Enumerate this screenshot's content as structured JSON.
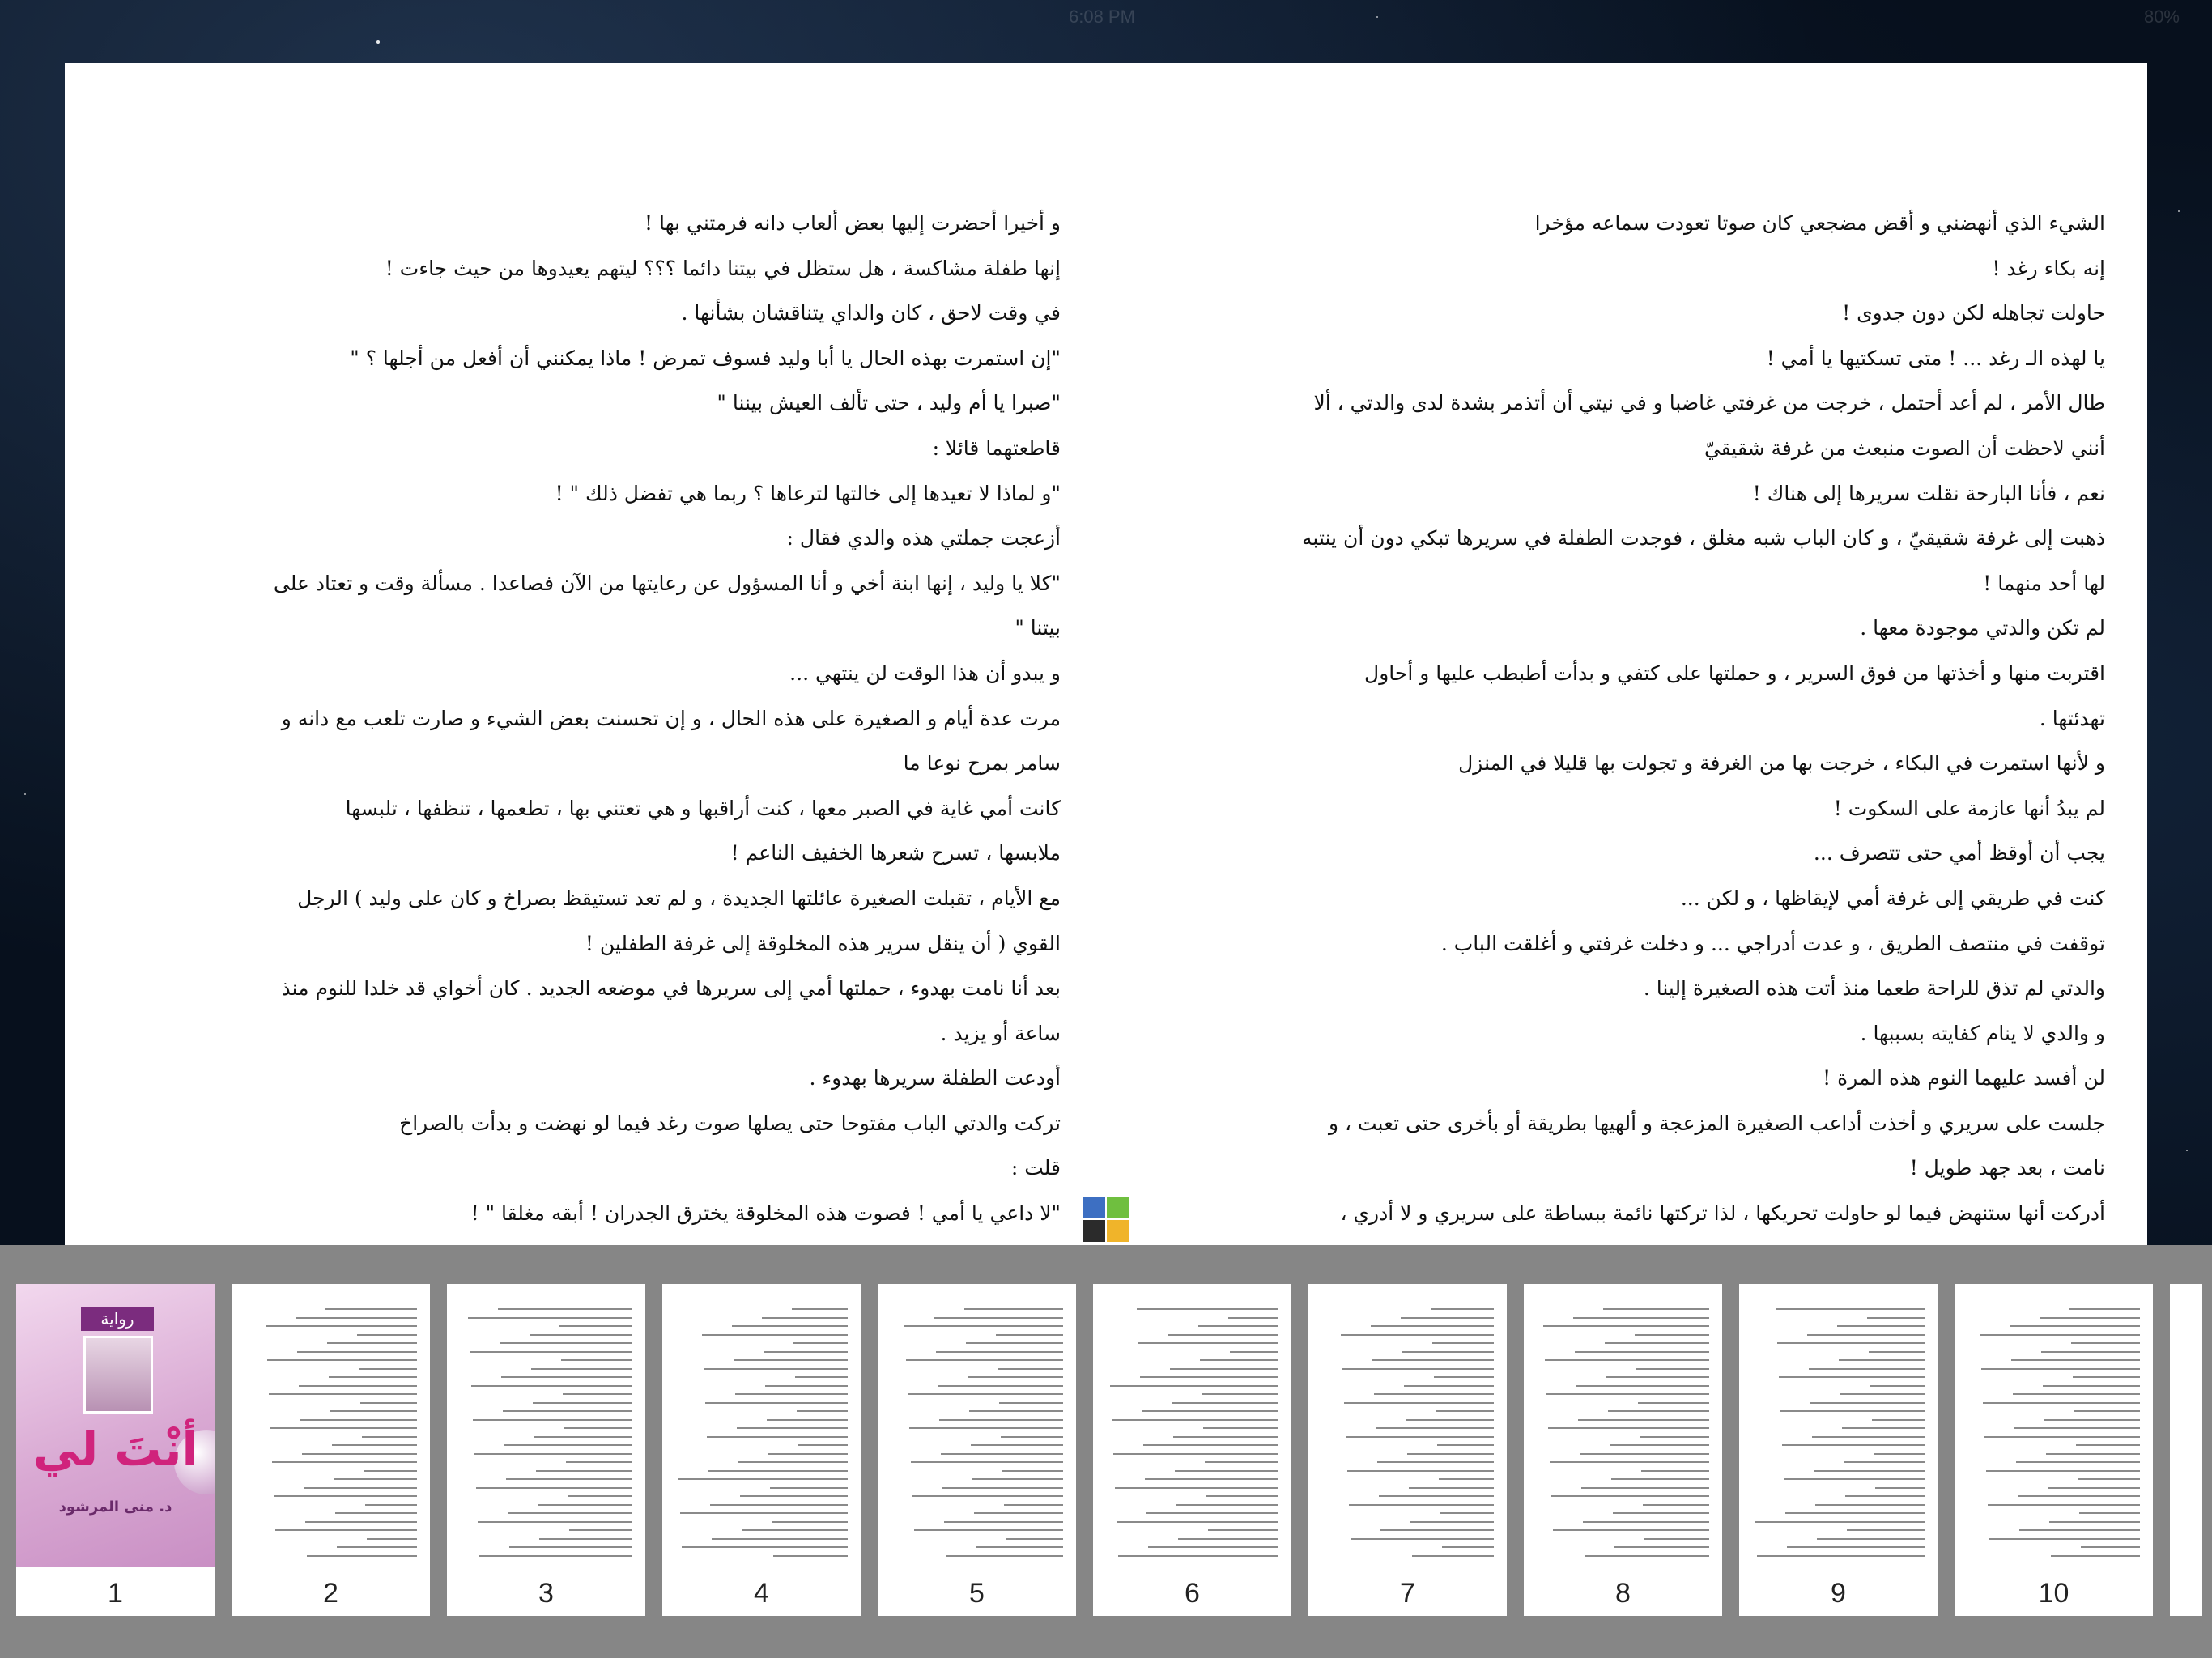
{
  "status_bar": {
    "time": "6:08 PM",
    "battery": "80%"
  },
  "book": {
    "right_page_lines": [
      "الشيء الذي أنهضني و أقض مضجعي كان صوتا تعودت سماعه مؤخرا",
      "إنه بكاء رغد !",
      "حاولت تجاهله لكن دون جدوى !",
      "يا لهذه الـ رغد ... ! متى تسكتيها يا أمي !",
      "طال الأمر ، لم أعد أحتمل ، خرجت من غرفتي غاضبا و في نيتي أن أتذمر بشدة لدى والدتي ، ألا",
      "أنني لاحظت أن الصوت منبعث من غرفة شقيقيّ",
      "نعم ، فأنا البارحة نقلت سريرها إلى هناك !",
      "ذهبت إلى غرفة شقيقيّ ، و كان الباب شبه مغلق ، فوجدت الطفلة في سريرها تبكي دون أن ينتبه",
      "لها أحد منهما !",
      "لم تكن والدتي موجودة معها .",
      "اقتربت منها و أخذتها من فوق السرير ، و حملتها على كتفي و بدأت أطبطب عليها و أحاول",
      "تهدئتها .",
      "و لأنها استمرت في البكاء ، خرجت بها من الغرفة و تجولت بها قليلا في المنزل",
      "لم يبدُ أنها عازمة على السكوت !",
      "يجب أن أوقظ أمي حتى تتصرف ...",
      "كنت في طريقي إلى غرفة أمي لإيقاظها ، و لكن ...",
      "توقفت في منتصف الطريق ، و عدت أدراجي ... و دخلت غرفتي و أغلقت الباب .",
      "والدتي لم تذق للراحة طعما منذ أتت هذه الصغيرة إلينا .",
      "و والدي لا ينام كفايته بسببها .",
      "لن أفسد عليهما النوم هذه المرة !",
      "جلست على سريري و أخذت أداعب الصغيرة المزعجة و ألهيها بطريقة أو بأخرى حتى تعبت ، و",
      "نامت ، بعد جهد طويل !",
      "أدركت أنها ستنهض فيما لو حاولت تحريكها ، لذا تركتها نائمة ببساطة على سريري و لا أدري ،"
    ],
    "left_page_lines": [
      "و أخيرا أحضرت إليها بعض ألعاب دانه فرمتني بها !",
      "إنها طفلة مشاكسة ، هل ستظل في بيتنا دائما ؟؟؟ ليتهم يعيدوها من حيث جاءت !",
      "في وقت لاحق ، كان والداي يتناقشان بشأنها .",
      "\"إن استمرت بهذه الحال يا أبا وليد فسوف تمرض ! ماذا يمكنني أن أفعل من أجلها ؟ \"",
      "\"صبرا يا أم وليد ، حتى تألف العيش بيننا \"",
      "قاطعتهما قائلا :",
      "\"و لماذا لا تعيدها إلى خالتها لترعاها ؟ ربما هي تفضل ذلك \" !",
      "أزعجت جملتي هذه والدي فقال :",
      "\"كلا يا وليد ، إنها ابنة أخي و أنا المسؤول عن رعايتها من الآن فصاعدا . مسألة وقت و تعتاد على",
      "بيتنا \"",
      "و يبدو أن هذا الوقت لن ينتهي ...",
      "مرت عدة أيام و الصغيرة على هذه الحال ، و إن تحسنت بعض الشيء و صارت تلعب مع دانه و",
      "سامر بمرح نوعا ما",
      "كانت أمي غاية في الصبر معها ، كنت أراقبها و هي تعتني بها ، تطعمها ، تنظفها ، تلبسها",
      "ملابسها ، تسرح شعرها الخفيف الناعم !",
      "مع الأيام ، تقبلت الصغيرة عائلتها الجديدة ، و لم تعد تستيقظ بصراخ و كان على وليد ) الرجل",
      "القوي ( أن ينقل سرير هذه المخلوقة إلى غرفة الطفلين !",
      "بعد أنا نامت بهدوء ، حملتها أمي إلى سريرها في موضعه الجديد . كان أخواي قد خلدا للنوم منذ",
      "ساعة أو يزيد .",
      "أودعت الطفلة سريرها بهدوء .",
      "تركت والدتي الباب مفتوحا حتى يصلها صوت رغد فيما لو نهضت و بدأت بالصراخ",
      "قلت :",
      "\"لا داعي يا أمي ! فصوت هذه المخلوقة يخترق الجدران ! أبقه مغلقا \" !"
    ]
  },
  "thumbnails": {
    "cover": {
      "label": "رواية",
      "title": "أنْتَ لي",
      "author": "د. منى المرشود"
    },
    "pages": [
      "1",
      "2",
      "3",
      "4",
      "5",
      "6",
      "7",
      "8",
      "9",
      "10"
    ]
  },
  "colors": {
    "thumb_bar": "#868686",
    "cover_title": "#d0237c",
    "spread_icon": [
      "#3d6fc2",
      "#6fbf3f",
      "#2b2b2b",
      "#f0b42a"
    ]
  }
}
